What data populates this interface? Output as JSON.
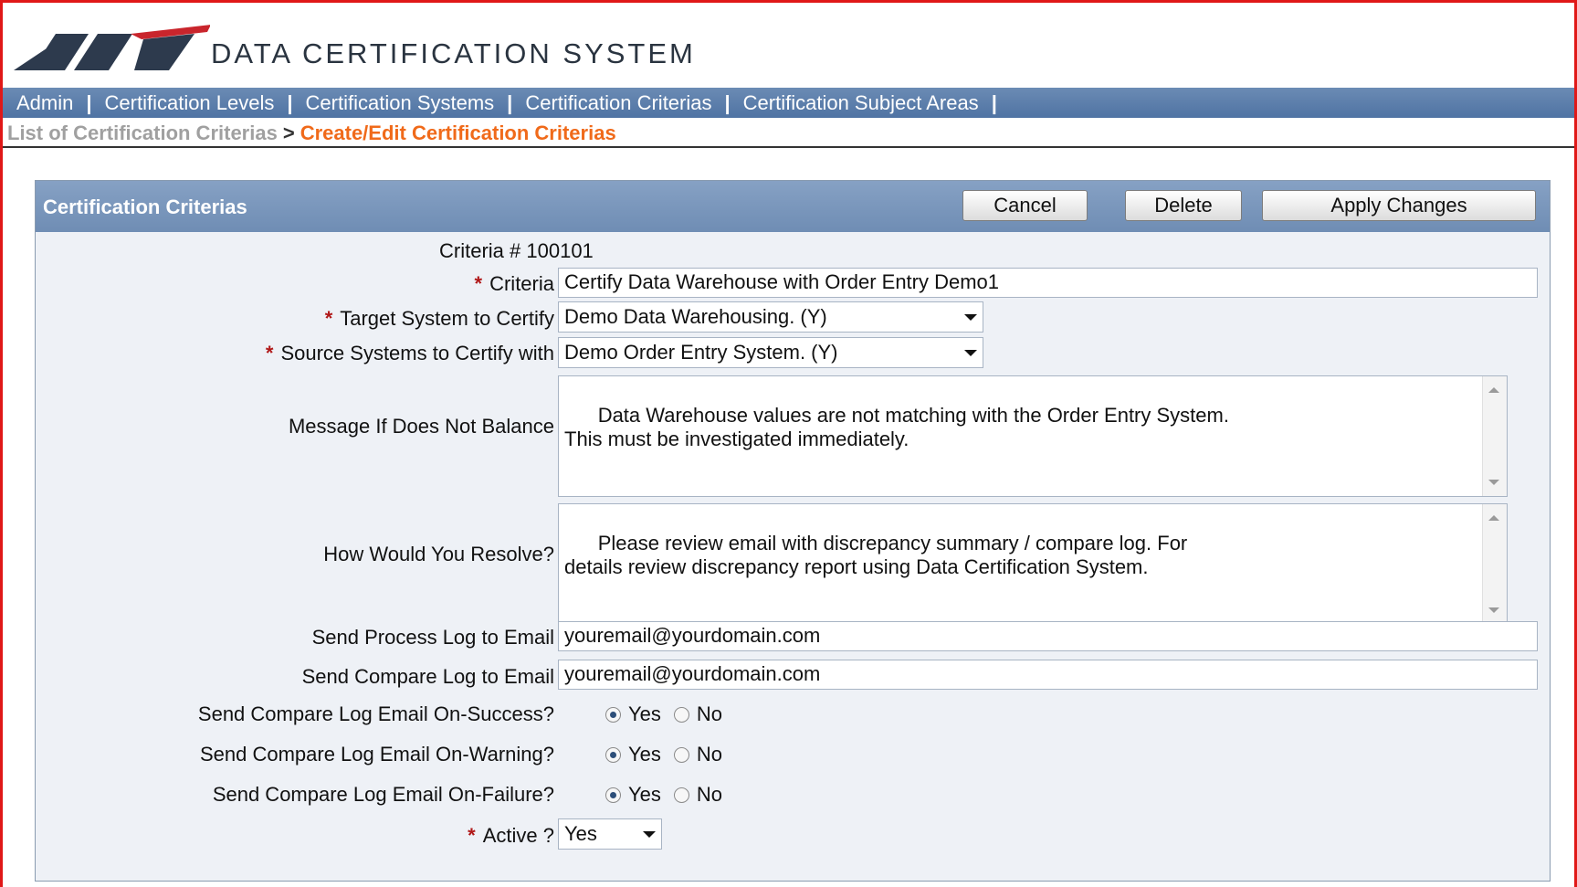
{
  "app": {
    "title": "DATA CERTIFICATION SYSTEM",
    "accent_color": "#4f73a3",
    "border_color": "#e01818"
  },
  "nav": {
    "items": [
      {
        "label": "Admin"
      },
      {
        "label": "Certification Levels"
      },
      {
        "label": "Certification Systems"
      },
      {
        "label": "Certification Criterias"
      },
      {
        "label": "Certification Subject Areas"
      }
    ],
    "separator": "|"
  },
  "breadcrumb": {
    "parent": "List of Certification Criterias",
    "arrow": ">",
    "current": "Create/Edit Certification Criterias"
  },
  "panel": {
    "title": "Certification Criterias",
    "buttons": {
      "cancel": "Cancel",
      "delete": "Delete",
      "apply": "Apply Changes"
    }
  },
  "form": {
    "required_marker": "*",
    "criteria_number": {
      "label": "Criteria #",
      "value": "100101"
    },
    "criteria": {
      "label": "Criteria",
      "value": "Certify Data  Warehouse with Order Entry Demo1"
    },
    "target_system": {
      "label": "Target System to Certify",
      "value": "Demo Data Warehousing. (Y)"
    },
    "source_systems": {
      "label": "Source Systems to Certify with",
      "value": "Demo Order Entry System. (Y)"
    },
    "message": {
      "label": "Message If Does Not Balance",
      "value": "Data Warehouse values are not matching with the Order Entry System.\nThis must be investigated immediately."
    },
    "resolve": {
      "label": "How Would You Resolve?",
      "value": "Please review email with discrepancy summary / compare log. For\ndetails review discrepancy report using Data Certification System."
    },
    "process_log_email": {
      "label": "Send Process Log to Email",
      "value": "youremail@yourdomain.com"
    },
    "compare_log_email": {
      "label": "Send Compare Log to Email",
      "value": "youremail@yourdomain.com"
    },
    "on_success": {
      "label": "Send Compare Log Email On-Success?",
      "selected": "Yes"
    },
    "on_warning": {
      "label": "Send Compare Log Email On-Warning?",
      "selected": "Yes"
    },
    "on_failure": {
      "label": "Send Compare Log Email On-Failure?",
      "selected": "Yes"
    },
    "radio_options": {
      "yes": "Yes",
      "no": "No"
    },
    "active": {
      "label": "Active ?",
      "value": "Yes"
    }
  }
}
